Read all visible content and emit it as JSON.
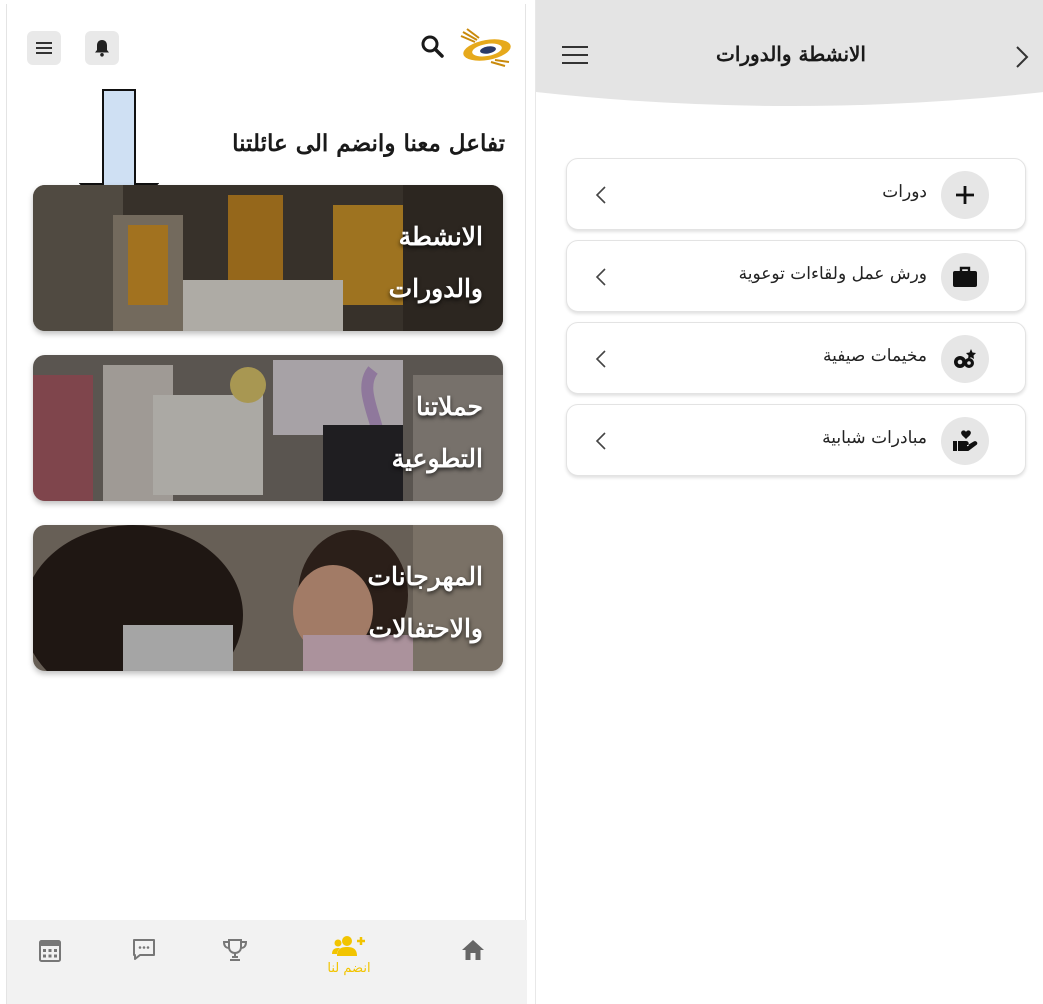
{
  "left": {
    "tagline": "تفاعل معنا وانضم الى عائلتنا",
    "cards": [
      {
        "line1": "الانشطة",
        "line2": "والدورات"
      },
      {
        "line1": "حملاتنا",
        "line2": "التطوعية"
      },
      {
        "line1": "المهرجانات",
        "line2": "والاحتفالات"
      }
    ],
    "bottom_nav": {
      "join_label": "انضم لنا",
      "items": [
        "calendar-icon",
        "chat-icon",
        "trophy-icon",
        "join-icon",
        "home-icon"
      ]
    },
    "colors": {
      "accent": "#f2c400",
      "arrow_fill": "#cfe0f3"
    }
  },
  "right": {
    "title": "الانشطة والدورات",
    "items": [
      {
        "label": "دورات",
        "icon": "plus-icon"
      },
      {
        "label": "ورش عمل ولقاءات توعوية",
        "icon": "briefcase-icon"
      },
      {
        "label": "مخيمات صيفية",
        "icon": "camp-icon"
      },
      {
        "label": "مبادرات شبابية",
        "icon": "hand-heart-icon"
      }
    ]
  }
}
